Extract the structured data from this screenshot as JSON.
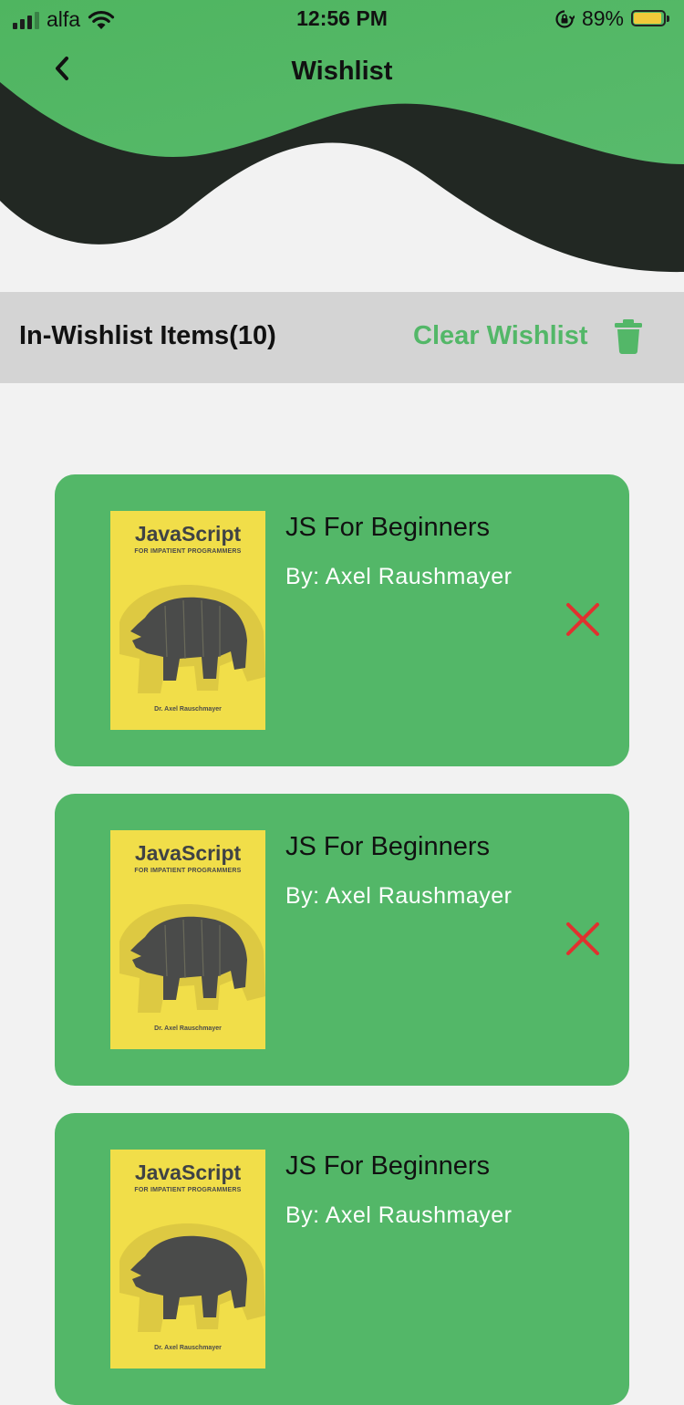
{
  "status_bar": {
    "carrier": "alfa",
    "time": "12:56 PM",
    "battery": "89%"
  },
  "nav": {
    "title": "Wishlist"
  },
  "list_header": {
    "title": "In-Wishlist Items(10)",
    "clear_label": "Clear Wishlist"
  },
  "items": [
    {
      "title": "JS For Beginners",
      "author": "By: Axel Raushmayer",
      "cover_title": "JavaScript",
      "cover_subtitle": "FOR IMPATIENT PROGRAMMERS",
      "cover_author": "Dr. Axel Rauschmayer"
    },
    {
      "title": "JS For Beginners",
      "author": "By: Axel Raushmayer",
      "cover_title": "JavaScript",
      "cover_subtitle": "FOR IMPATIENT PROGRAMMERS",
      "cover_author": "Dr. Axel Rauschmayer"
    },
    {
      "title": "JS For Beginners",
      "author": "By: Axel Raushmayer",
      "cover_title": "JavaScript",
      "cover_subtitle": "FOR IMPATIENT PROGRAMMERS",
      "cover_author": "Dr. Axel Rauschmayer"
    }
  ],
  "colors": {
    "accent": "#53b768",
    "wave_dark": "#222823",
    "remove": "#e0312f",
    "cover_yellow": "#f1de49"
  },
  "icons": {
    "back": "chevron-left-icon",
    "trash": "trash-icon",
    "remove": "close-icon"
  }
}
